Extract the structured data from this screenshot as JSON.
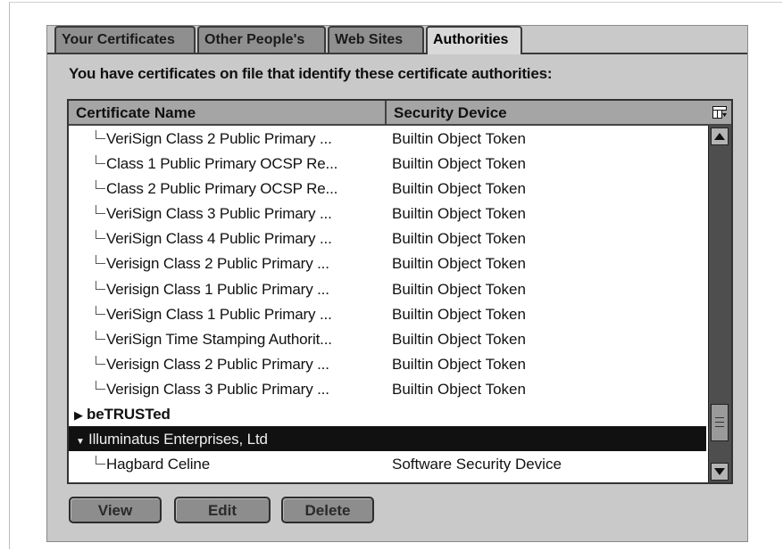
{
  "tabs": [
    {
      "label": "Your Certificates",
      "active": false
    },
    {
      "label": "Other People's",
      "active": false
    },
    {
      "label": "Web Sites",
      "active": false
    },
    {
      "label": "Authorities",
      "active": true
    }
  ],
  "prompt_text": "You have certificates on file that identify these certificate authorities:",
  "table": {
    "columns": [
      "Certificate Name",
      "Security Device"
    ],
    "column_picker_icon": "column-picker-icon",
    "rows": [
      {
        "type": "child",
        "name": "VeriSign Class 2 Public Primary ...",
        "device": "Builtin Object Token"
      },
      {
        "type": "child",
        "name": "Class 1 Public Primary OCSP Re...",
        "device": "Builtin Object Token"
      },
      {
        "type": "child",
        "name": "Class 2 Public Primary OCSP Re...",
        "device": "Builtin Object Token"
      },
      {
        "type": "child",
        "name": "VeriSign Class 3 Public Primary ...",
        "device": "Builtin Object Token"
      },
      {
        "type": "child",
        "name": "VeriSign Class 4 Public Primary ...",
        "device": "Builtin Object Token"
      },
      {
        "type": "child",
        "name": "Verisign Class 2 Public Primary ...",
        "device": "Builtin Object Token"
      },
      {
        "type": "child",
        "name": "Verisign Class 1 Public Primary ...",
        "device": "Builtin Object Token"
      },
      {
        "type": "child",
        "name": "VeriSign Class 1 Public Primary ...",
        "device": "Builtin Object Token"
      },
      {
        "type": "child",
        "name": "VeriSign Time Stamping Authorit...",
        "device": "Builtin Object Token"
      },
      {
        "type": "child",
        "name": "Verisign Class 2 Public Primary ...",
        "device": "Builtin Object Token"
      },
      {
        "type": "child",
        "name": "Verisign Class 3 Public Primary ...",
        "device": "Builtin Object Token"
      },
      {
        "type": "group-collapsed",
        "name": "beTRUSTed",
        "device": ""
      },
      {
        "type": "group-expanded-selected",
        "name": "Illuminatus Enterprises, Ltd",
        "device": ""
      },
      {
        "type": "child",
        "name": "Hagbard Celine",
        "device": "Software Security Device"
      }
    ]
  },
  "buttons": {
    "view": "View",
    "edit": "Edit",
    "delete": "Delete"
  },
  "colors": {
    "dialog_bg": "#c9c9c9",
    "selected_row": "#111111",
    "scrollbar_track": "#4e4e4e"
  }
}
